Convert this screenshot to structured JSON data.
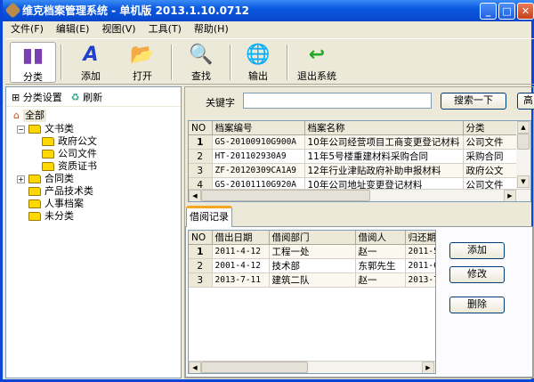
{
  "window": {
    "title": "维克档案管理系统 - 单机版 2013.1.10.0712",
    "minimize": "_",
    "maximize": "□",
    "close": "✕"
  },
  "menu": [
    "文件(F)",
    "编辑(E)",
    "视图(V)",
    "工具(T)",
    "帮助(H)"
  ],
  "toolbar": [
    {
      "label": "分类",
      "icon": "bar-chart-icon"
    },
    {
      "label": "添加",
      "icon": "letter-a-icon"
    },
    {
      "label": "打开",
      "icon": "open-folder-icon"
    },
    {
      "label": "查找",
      "icon": "magnifier-icon"
    },
    {
      "label": "输出",
      "icon": "export-globe-icon"
    },
    {
      "label": "退出系统",
      "icon": "exit-arrow-icon"
    }
  ],
  "left": {
    "category_settings": "分类设置",
    "refresh": "刷新",
    "tree": {
      "root": "全部",
      "n1": "文书类",
      "n1a": "政府公文",
      "n1b": "公司文件",
      "n1c": "资质证书",
      "n2": "合同类",
      "n3": "产品技术类",
      "n4": "人事档案",
      "n5": "未分类"
    }
  },
  "search": {
    "label": "关键字",
    "value": "",
    "button": "搜索一下",
    "button2": "高"
  },
  "archives": {
    "columns": [
      "NO",
      "档案编号",
      "档案名称",
      "分类"
    ],
    "rows": [
      [
        "1",
        "GS-20100910G900A",
        "10年公司经营项目工商变更登记材料",
        "公司文件"
      ],
      [
        "2",
        "HT-201102930A9",
        "11年5号楼重建材料采购合同",
        "采购合同"
      ],
      [
        "3",
        "ZF-20120309CA1A9",
        "12年行业津贴政府补助申报材料",
        "政府公文"
      ],
      [
        "4",
        "GS-20101110G920A",
        "10年公司地址变更登记材料",
        "公司文件"
      ]
    ]
  },
  "borrow": {
    "tab": "借阅记录",
    "columns": [
      "NO",
      "借出日期",
      "借阅部门",
      "借阅人",
      "归还期"
    ],
    "rows": [
      [
        "1",
        "2011-4-12",
        "工程一处",
        "赵一",
        "2011-5-"
      ],
      [
        "2",
        "2001-4-12",
        "技术部",
        "东郭先生",
        "2011-6-"
      ],
      [
        "3",
        "2013-7-11",
        "建筑二队",
        "赵一",
        "2013-7-"
      ]
    ],
    "add": "添加",
    "edit": "修改",
    "delete": "删除"
  }
}
